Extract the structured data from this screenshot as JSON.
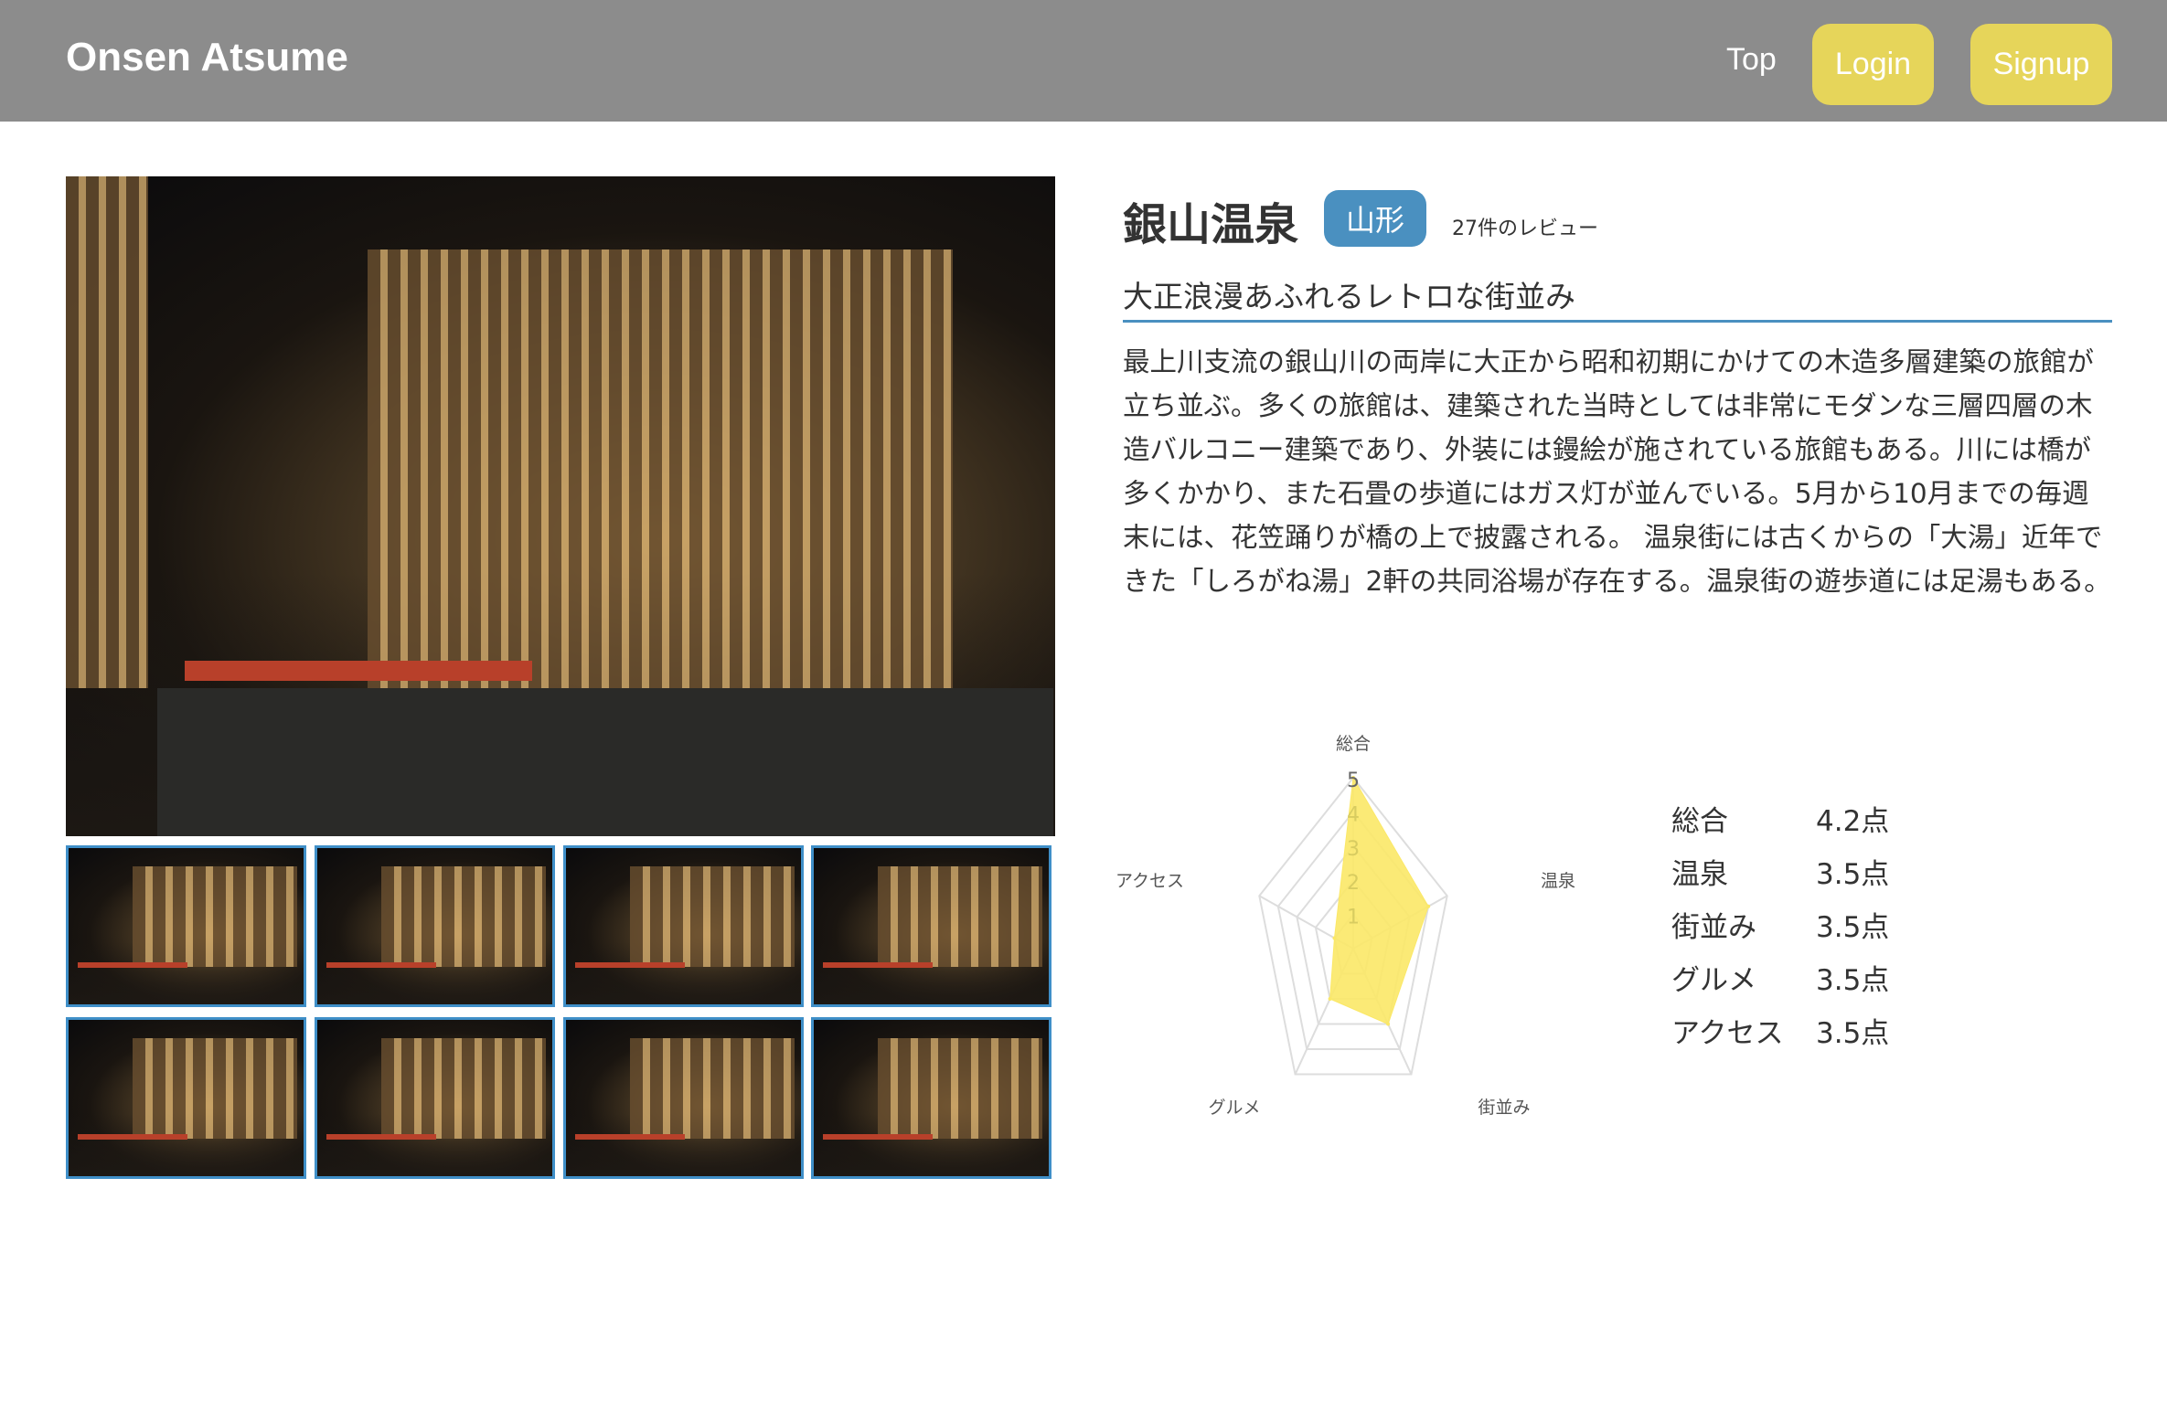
{
  "header": {
    "brand": "Onsen Atsume",
    "nav": {
      "top": "Top",
      "login": "Login",
      "signup": "Signup"
    },
    "button_color": "#e6d55a"
  },
  "onsen": {
    "name": "銀山温泉",
    "prefecture": "山形",
    "review_count": "27件のレビュー",
    "catchphrase": "大正浪漫あふれるレトロな街並み",
    "description": "最上川支流の銀山川の両岸に大正から昭和初期にかけての木造多層建築の旅館が立ち並ぶ。多くの旅館は、建築された当時としては非常にモダンな三層四層の木造バルコニー建築であり、外装には鏝絵が施されている旅館もある。川には橋が多くかかり、また石畳の歩道にはガス灯が並んでいる。5月から10月までの毎週末には、花笠踊りが橋の上で披露される。 温泉街には古くからの「大湯」近年できた「しろがね湯」2軒の共同浴場が存在する。温泉街の遊歩道には足湯もある。",
    "accent_color": "#4a90c0",
    "thumbnail_count": 8
  },
  "scores": [
    {
      "label": "総合",
      "value": "4.2点"
    },
    {
      "label": "温泉",
      "value": "3.5点"
    },
    {
      "label": "街並み",
      "value": "3.5点"
    },
    {
      "label": "グルメ",
      "value": "3.5点"
    },
    {
      "label": "アクセス",
      "value": "3.5点"
    }
  ],
  "chart_data": {
    "type": "radar",
    "categories": [
      "総合",
      "温泉",
      "街並み",
      "グルメ",
      "アクセス"
    ],
    "values": [
      5,
      4,
      3,
      2,
      1
    ],
    "rlim": [
      0,
      5
    ],
    "ticks": [
      "1",
      "2",
      "3",
      "4",
      "5"
    ],
    "fill_color": "#fbe867",
    "grid": true
  }
}
